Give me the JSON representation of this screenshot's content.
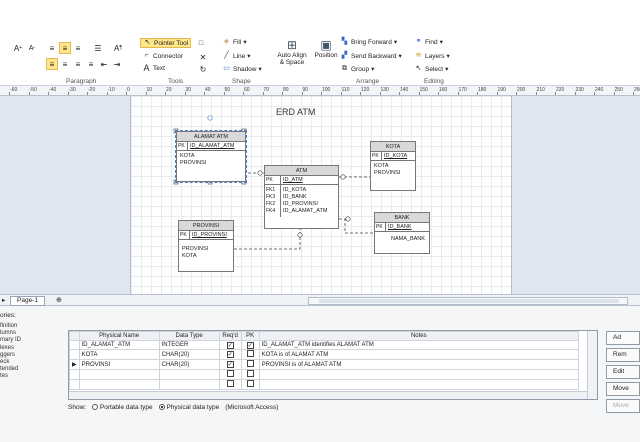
{
  "ribbon": {
    "groups": {
      "paragraph": "Paragraph",
      "tools": "Tools",
      "shape": "Shape",
      "arrange": "Arrange",
      "editing": "Editing"
    },
    "tools": {
      "pointer": "Pointer Tool",
      "connector": "Connector",
      "text": "Text"
    },
    "shape": {
      "fill": "Fill",
      "line": "Line",
      "shadow": "Shadow"
    },
    "arrange": {
      "auto_align": "Auto Align",
      "auto_align2": "& Space",
      "position": "Position",
      "bring_forward": "Bring Forward",
      "send_backward": "Send Backward",
      "group": "Group"
    },
    "editing": {
      "find": "Find",
      "layers": "Layers",
      "select": "Select"
    }
  },
  "ruler": [
    "-60",
    "-50",
    "-40",
    "-30",
    "-20",
    "-10",
    "0",
    "10",
    "20",
    "30",
    "40",
    "50",
    "60",
    "70",
    "80",
    "90",
    "100",
    "110",
    "120",
    "130",
    "140",
    "150",
    "160",
    "170",
    "180",
    "190",
    "200",
    "210",
    "220",
    "230",
    "240",
    "250",
    "260"
  ],
  "diagram": {
    "title": "ERD ATM",
    "alamat_atm": {
      "name": "ALAMAT ATM",
      "pk": "PK",
      "pk_field": "ID_ALAMAT_ATM",
      "attrs": [
        "KOTA",
        "PROVINSI"
      ]
    },
    "atm": {
      "name": "ATM",
      "pk": "PK",
      "pk_field": "ID_ATM",
      "fks": [
        "FK1",
        "FK3",
        "FK2",
        "FK4"
      ],
      "fields": [
        "ID_KOTA",
        "ID_BANK",
        "ID_PROVINSI",
        "ID_ALAMAT_ATM"
      ]
    },
    "kota": {
      "name": "KOTA",
      "pk": "PK",
      "pk_field": "ID_KOTA",
      "attrs": [
        "KOTA",
        "PROVINSI"
      ]
    },
    "bank": {
      "name": "BANK",
      "pk": "PK",
      "pk_field": "ID_BANK",
      "attrs": [
        "NAMA_BANK"
      ]
    },
    "provinsi": {
      "name": "PROVINSI",
      "pk": "PK",
      "pk_field": "ID_PROVINSI",
      "attrs": [
        "PROVINSI",
        "KOTA"
      ]
    }
  },
  "page_tab": "Page-1",
  "categories": {
    "title": "ories:",
    "items": [
      "finition",
      "lumns",
      "mary ID",
      "lexes",
      "ggers",
      "eck",
      "tended",
      "tes"
    ]
  },
  "grid": {
    "headers": [
      "Physical Name",
      "Data Type",
      "Req'd",
      "PK",
      "Notes"
    ],
    "rows": [
      {
        "name": "ID_ALAMAT_ATM",
        "type": "INTEGER",
        "req": "✓",
        "pk": "✓",
        "notes": "ID_ALAMAT_ATM identifies ALAMAT ATM"
      },
      {
        "name": "KOTA",
        "type": "CHAR(20)",
        "req": "✓",
        "pk": "",
        "notes": "KOTA is of ALAMAT ATM"
      },
      {
        "name": "PROVINSI",
        "type": "CHAR(20)",
        "req": "✓",
        "pk": "",
        "notes": "PROVINSI is of ALAMAT ATM"
      }
    ]
  },
  "show": {
    "label": "Show:",
    "portable": "Portable data type",
    "physical": "Physical data type",
    "provider": "(Microsoft Access)"
  },
  "side_buttons": [
    "Ad",
    "Rem",
    "Edit",
    "Move",
    "Move"
  ]
}
